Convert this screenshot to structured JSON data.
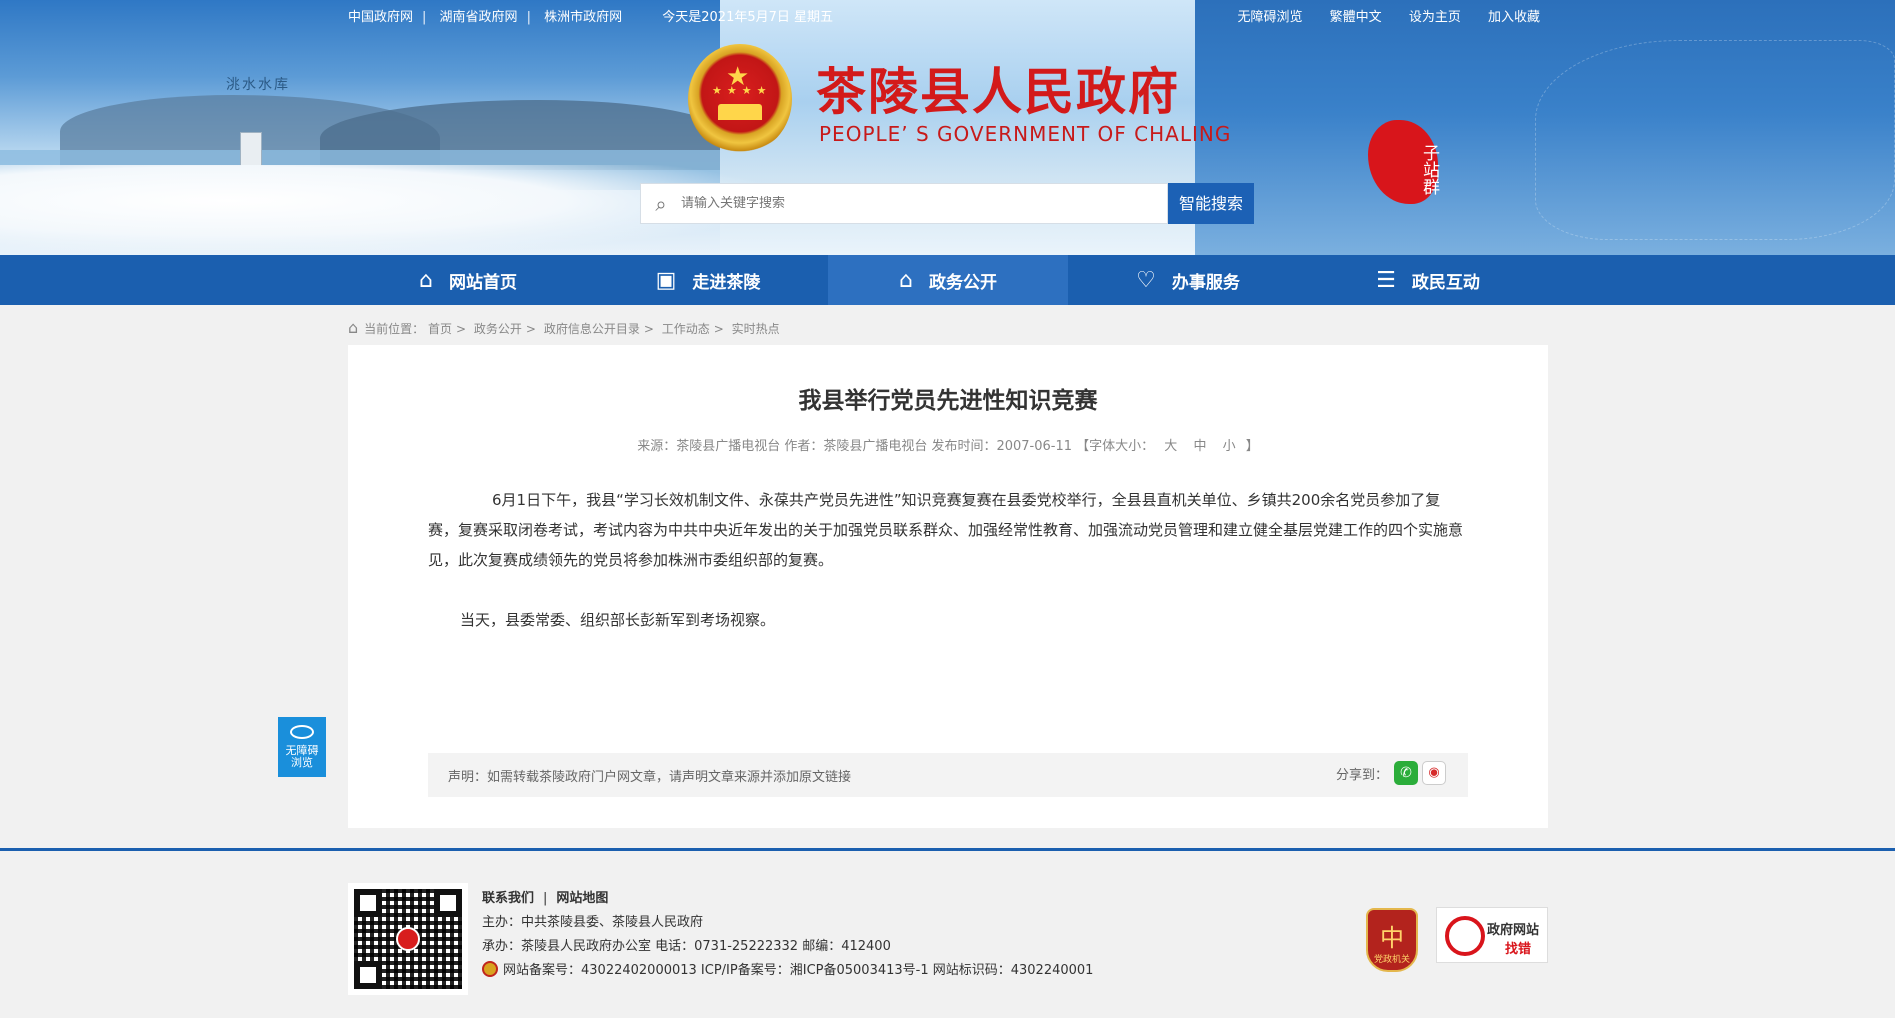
{
  "top_links": {
    "gov_cn": "中国政府网",
    "hunan": "湖南省政府网",
    "zhuzhou": "株洲市政府网",
    "date": "今天是2021年5月7日 星期五",
    "accessible": "无障碍浏览",
    "traditional": "繁體中文",
    "set_home": "设为主页",
    "bookmark": "加入收藏"
  },
  "banner": {
    "caption": "洮水水库",
    "title": "茶陵县人民政府",
    "subtitle": "PEOPLE’ S GOVERNMENT OF CHALING",
    "substation": "子站群"
  },
  "search": {
    "placeholder": "请输入关键字搜索",
    "button": "智能搜索"
  },
  "nav": [
    {
      "label": "网站首页",
      "icon": "home-icon"
    },
    {
      "label": "走进茶陵",
      "icon": "picture-icon"
    },
    {
      "label": "政务公开",
      "icon": "building-icon"
    },
    {
      "label": "办事服务",
      "icon": "heart-icon"
    },
    {
      "label": "政民互动",
      "icon": "chat-icon"
    }
  ],
  "breadcrumb": {
    "label": "当前位置：",
    "items": [
      "首页",
      "政务公开",
      "政府信息公开目录",
      "工作动态",
      "实时热点"
    ]
  },
  "article": {
    "title": "我县举行党员先进性知识竞赛",
    "meta_prefix": "来源：茶陵县广播电视台 作者：茶陵县广播电视台 发布时间：2007-06-11 【字体大小：",
    "font_large": "大",
    "font_mid": "中",
    "font_small": "小",
    "meta_suffix": " 】",
    "paragraphs": [
      "6月1日下午，我县“学习长效机制文件、永葆共产党员先进性”知识竞赛复赛在县委党校举行，全县县直机关单位、乡镇共200余名党员参加了复赛，复赛采取闭卷考试，考试内容为中共中央近年发出的关于加强党员联系群众、加强经常性教育、加强流动党员管理和建立健全基层党建工作的四个实施意见，此次复赛成绩领先的党员将参加株洲市委组织部的复赛。",
      "当天，县委常委、组织部长彭新军到考场视察。"
    ],
    "notice": "声明：如需转载茶陵政府门户网文章，请声明文章来源并添加原文链接",
    "share_label": "分享到："
  },
  "a11y_float": {
    "line1": "无障碍",
    "line2": "浏览"
  },
  "footer": {
    "contact": "联系我们",
    "sitemap": "网站地图",
    "host": "主办：中共茶陵县委、茶陵县人民政府",
    "organizer": "承办：茶陵县人民政府办公室 电话：0731-25222332 邮编：412400",
    "record": "网站备案号：43022402000013 ICP/IP备案号：湘ICP备05003413号-1 网站标识码：4302240001",
    "party_badge": "党政机关",
    "error_line1": "政府网站",
    "error_line2": "找错"
  },
  "colors": {
    "nav": "#1b5faf",
    "nav_active": "#2d70c0",
    "title_red": "#d31a1a",
    "search_btn": "#1c61b5"
  }
}
